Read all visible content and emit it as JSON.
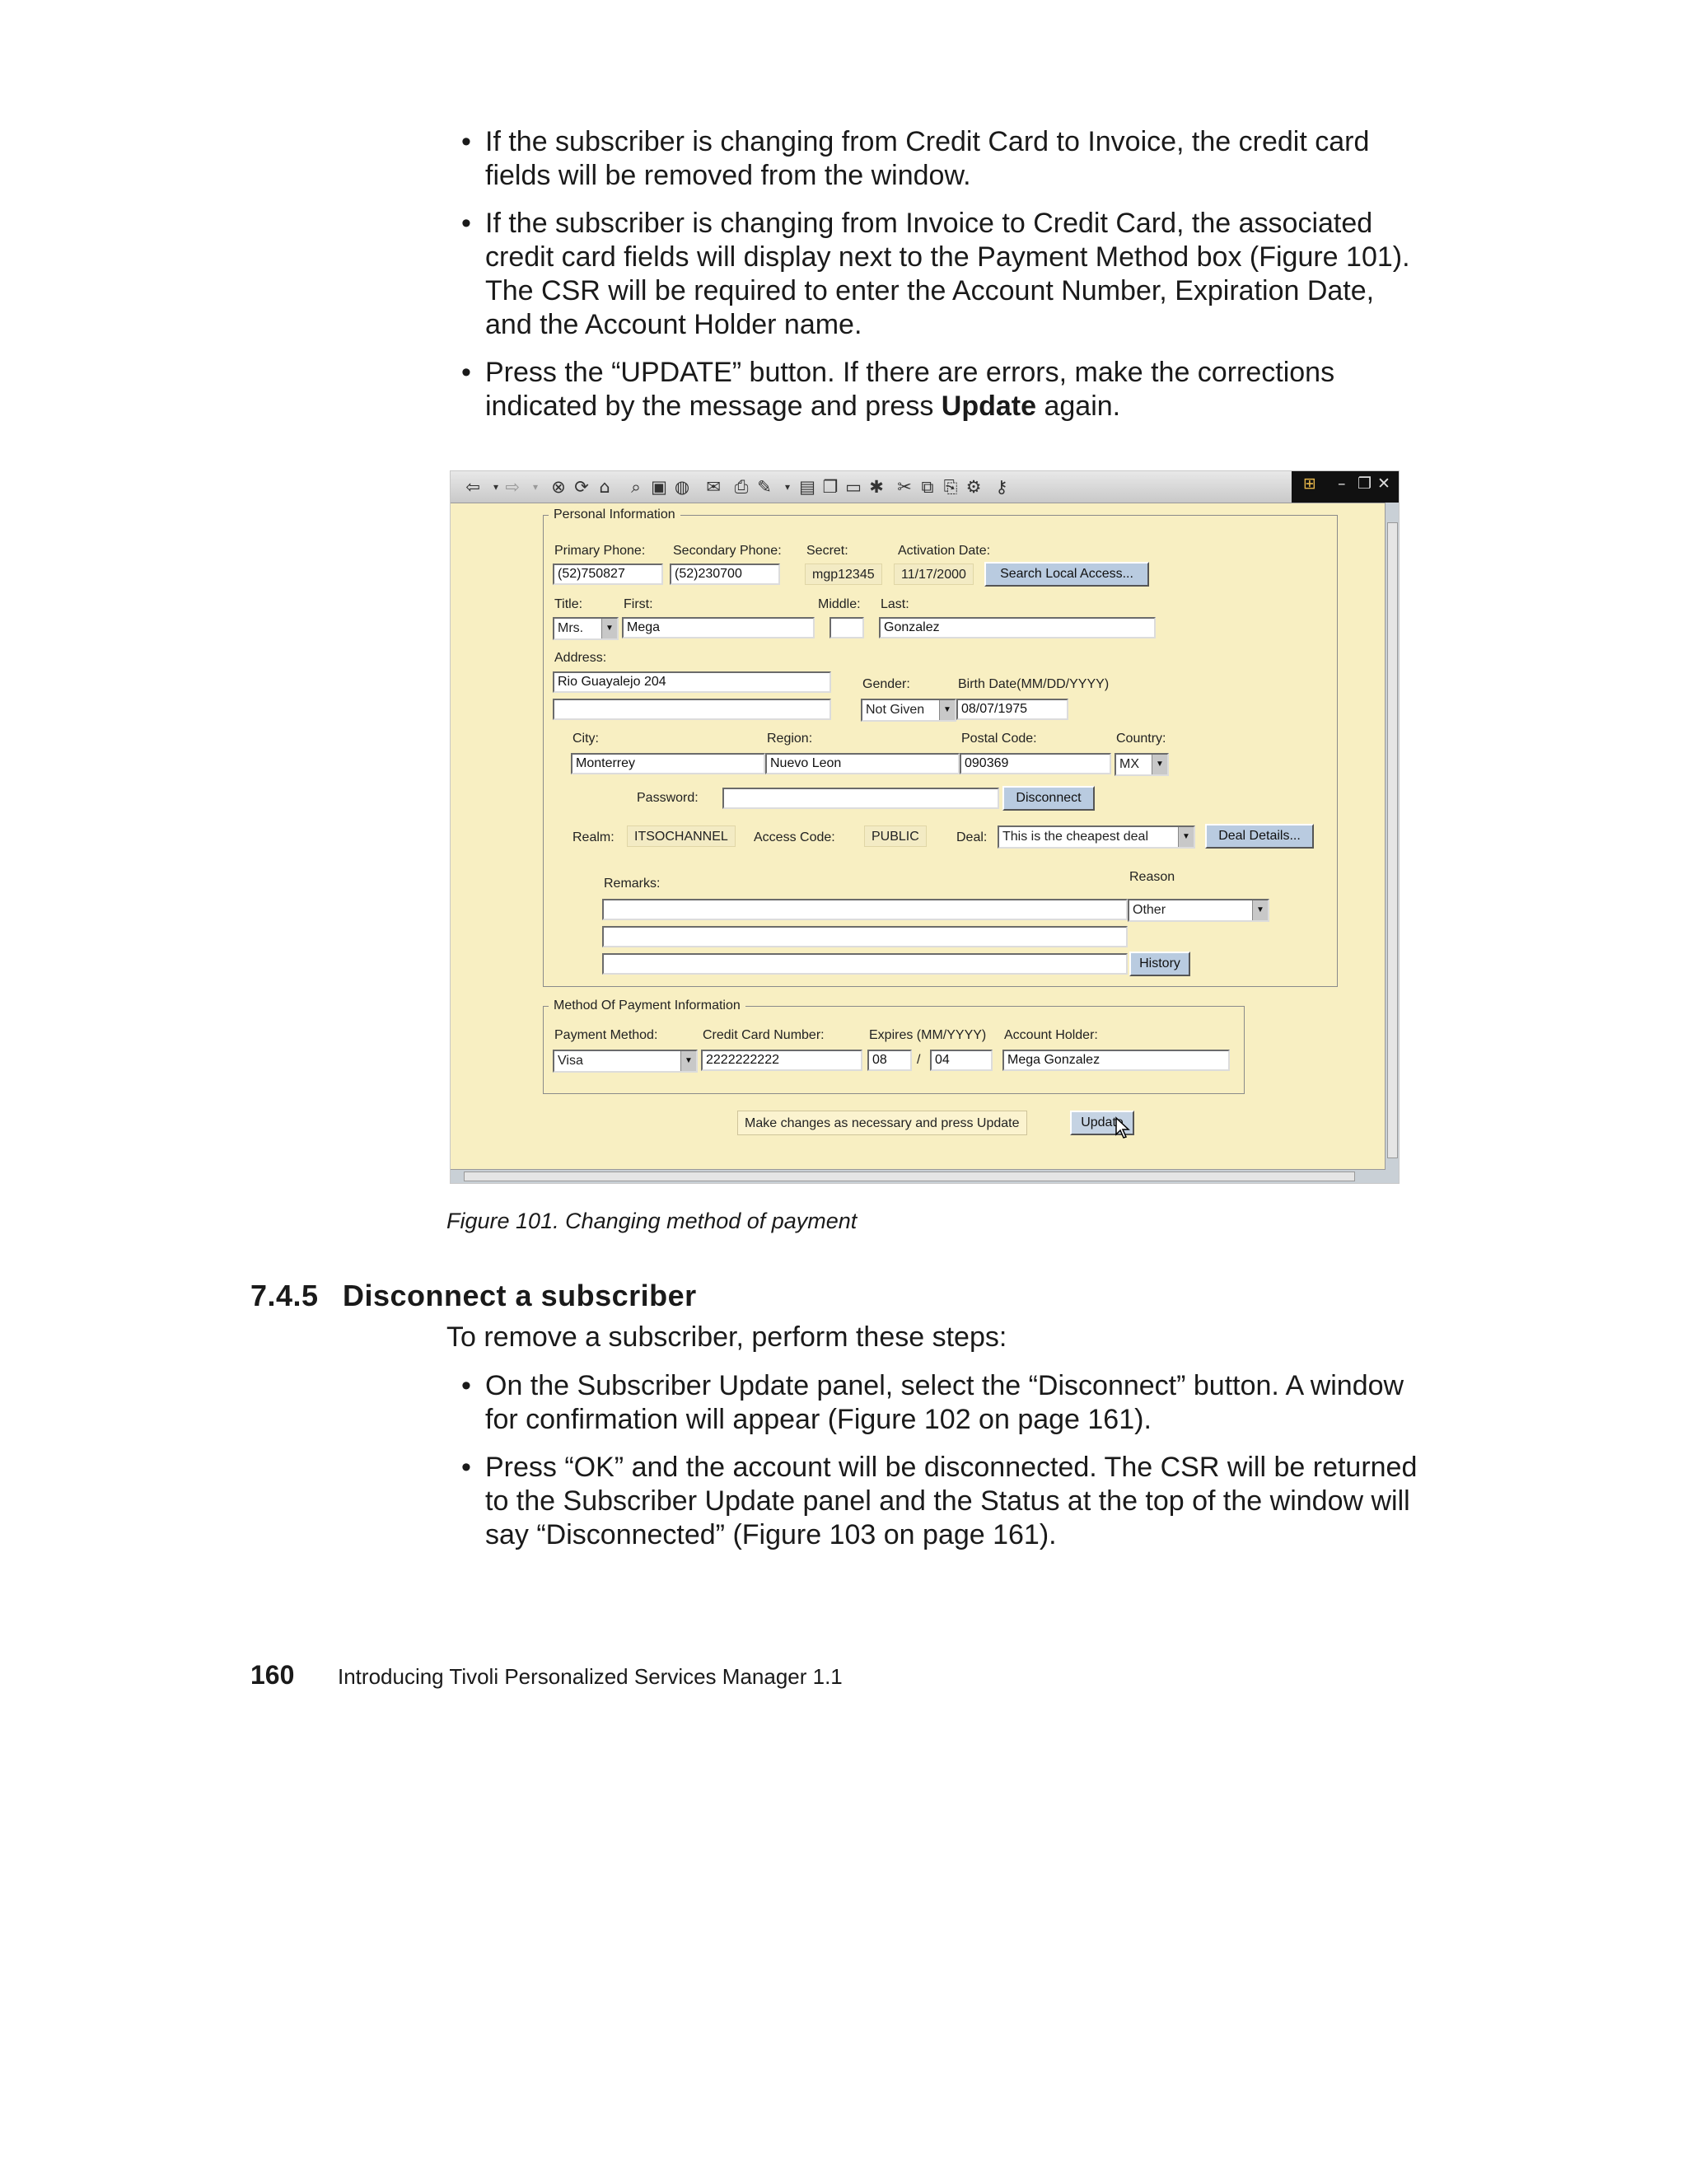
{
  "bullets_top": [
    {
      "text": "If the subscriber is changing from Credit Card to Invoice, the credit card fields will be removed from the window."
    },
    {
      "text": "If the subscriber is changing from Invoice to Credit Card, the associated credit card fields will display next to the Payment Method box (Figure 101). The CSR will be required to enter the Account Number, Expiration Date, and the Account Holder name."
    },
    {
      "before": "Press the “UPDATE” button. If there are errors, make the corrections indicated by the message and press ",
      "bold": "Update",
      "after": " again."
    }
  ],
  "screenshot": {
    "toolbar_icons": [
      "back-icon",
      "forward-icon",
      "stop-icon",
      "refresh-icon",
      "home-icon",
      "search-icon",
      "favorites-icon",
      "history-icon",
      "mail-icon",
      "print-icon",
      "edit-icon",
      "discuss-icon",
      "cut-icon",
      "copy-icon",
      "paste-icon",
      "tools-icon"
    ],
    "personal": {
      "legend": "Personal Information",
      "primary_phone_label": "Primary Phone:",
      "primary_phone": "(52)750827",
      "secondary_phone_label": "Secondary Phone:",
      "secondary_phone": "(52)230700",
      "secret_label": "Secret:",
      "secret": "mgp12345",
      "activation_label": "Activation Date:",
      "activation": "11/17/2000",
      "search_btn": "Search Local Access...",
      "title_label": "Title:",
      "title": "Mrs.",
      "first_label": "First:",
      "first": "Mega",
      "middle_label": "Middle:",
      "middle": "",
      "last_label": "Last:",
      "last": "Gonzalez",
      "address_label": "Address:",
      "address1": "Rio Guayalejo 204",
      "address2": "",
      "gender_label": "Gender:",
      "gender": "Not Given",
      "birth_label": "Birth Date(MM/DD/YYYY)",
      "birth": "08/07/1975",
      "city_label": "City:",
      "city": "Monterrey",
      "region_label": "Region:",
      "region": "Nuevo Leon",
      "postal_label": "Postal Code:",
      "postal": "090369",
      "country_label": "Country:",
      "country": "MX",
      "password_label": "Password:",
      "password": "",
      "disconnect_btn": "Disconnect",
      "realm_label": "Realm:",
      "realm": "ITSOCHANNEL",
      "access_label": "Access Code:",
      "access": "PUBLIC",
      "deal_label": "Deal:",
      "deal": "This is the cheapest deal",
      "deal_btn": "Deal Details...",
      "remarks_label": "Remarks:",
      "reason_label": "Reason",
      "reason": "Other",
      "history_btn": "History"
    },
    "payment": {
      "legend": "Method Of Payment Information",
      "method_label": "Payment Method:",
      "method": "Visa",
      "cc_label": "Credit Card Number:",
      "cc": "2222222222",
      "expires_label": "Expires (MM/YYYY)",
      "exp_month": "08",
      "exp_sep": "/",
      "exp_year": "04",
      "holder_label": "Account Holder:",
      "holder": "Mega Gonzalez"
    },
    "status_msg": "Make changes as necessary and press Update",
    "update_btn": "Update"
  },
  "caption": "Figure 101.  Changing method of payment",
  "section_number": "7.4.5",
  "section_title": "Disconnect a subscriber",
  "intro": "To remove a subscriber, perform these steps:",
  "bullets_bottom": [
    {
      "text": "On the Subscriber Update panel, select the “Disconnect” button. A window for confirmation will appear (Figure 102 on page 161)."
    },
    {
      "text": "Press “OK” and the account will be disconnected. The CSR will be returned to the Subscriber Update panel and the Status at the top of the window will say “Disconnected” (Figure 103 on page 161)."
    }
  ],
  "footer_page": "160",
  "footer_title": "Introducing Tivoli Personalized Services Manager 1.1"
}
